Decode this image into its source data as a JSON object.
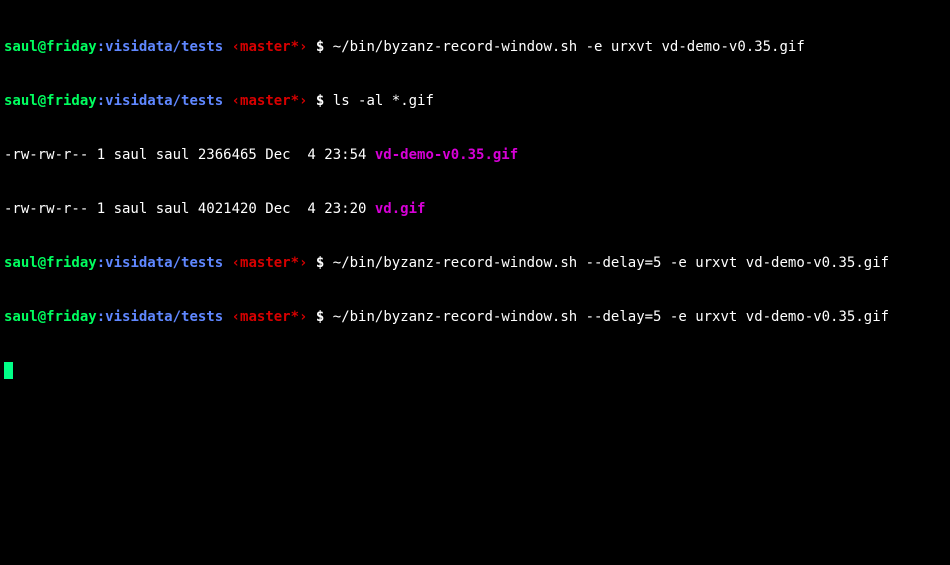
{
  "prompt": {
    "user_host": "saul@friday",
    "colon": ":",
    "path": "visidata/tests",
    "branch": " ‹master*›",
    "dollar": " $ "
  },
  "lines": {
    "cmd1": "~/bin/byzanz-record-window.sh -e urxvt vd-demo-v0.35.gif",
    "cmd2": "ls -al *.gif",
    "ls_row1_meta": "-rw-rw-r-- 1 saul saul 2366465 Dec  4 23:54 ",
    "ls_row1_file": "vd-demo-v0.35.gif",
    "ls_row2_meta": "-rw-rw-r-- 1 saul saul 4021420 Dec  4 23:20 ",
    "ls_row2_file": "vd.gif",
    "cmd3": "~/bin/byzanz-record-window.sh --delay=5 -e urxvt vd-demo-v0.35.gif",
    "cmd4": "~/bin/byzanz-record-window.sh --delay=5 -e urxvt vd-demo-v0.35.gif"
  }
}
